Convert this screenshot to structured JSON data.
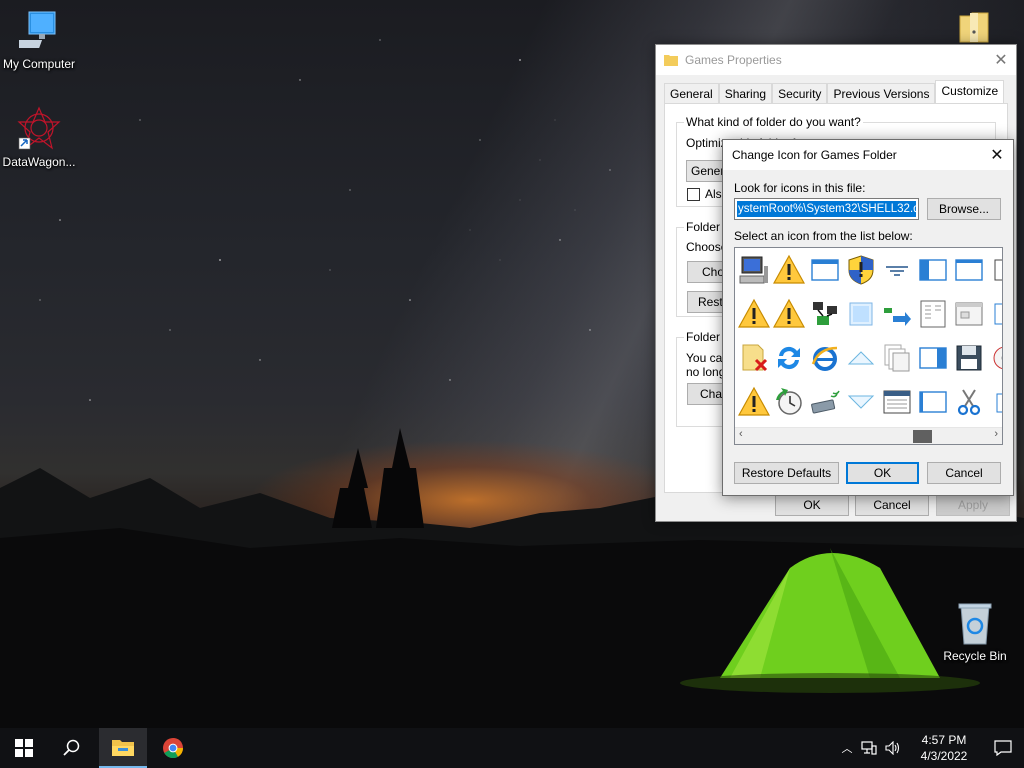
{
  "desktop": {
    "icons": [
      {
        "label": "My Computer"
      },
      {
        "label": "DataWagon..."
      },
      {
        "label": "Recycle Bin"
      }
    ]
  },
  "properties": {
    "title": "Games Properties",
    "tabs": [
      "General",
      "Sharing",
      "Security",
      "Previous Versions",
      "Customize"
    ],
    "selected_tab": "Customize",
    "group1_title": "What kind of folder do you want?",
    "optimize_label": "Optimize this folder for:",
    "optimize_value": "Genera",
    "also_apply_label": "Also",
    "group2_title": "Folder p",
    "choose_label": "Choose",
    "choose_button": "Cho",
    "restore_button": "Resto",
    "group3_title": "Folder ic",
    "you_can_label": "You can",
    "no_longer_label": "no longe",
    "change_button": "Char",
    "ok": "OK",
    "cancel": "Cancel",
    "apply": "Apply"
  },
  "change_icon": {
    "title": "Change Icon for Games Folder",
    "look_label": "Look for icons in this file:",
    "path_value": "ystemRoot%\\System32\\SHELL32.dll",
    "browse": "Browse...",
    "select_label": "Select an icon from the list below:",
    "icons": [
      "computer-monitor-icon",
      "warning-icon",
      "window-icon",
      "shield-icon",
      "filter-icon",
      "split-window-icon",
      "window-frame-icon",
      "warning-icon",
      "warning-icon",
      "network-icon",
      "blank-square-icon",
      "move-arrow-icon",
      "document-columns-icon",
      "dialog-window-icon",
      "folder-delete-icon",
      "refresh-icon",
      "internet-explorer-icon",
      "arrow-up-icon",
      "stacked-pages-icon",
      "window-pane-icon",
      "floppy-disk-icon",
      "warning-icon",
      "clock-icon",
      "usb-drive-icon",
      "arrow-down-icon",
      "grid-window-icon",
      "window-blank-icon",
      "scissors-icon"
    ],
    "restore_defaults": "Restore Defaults",
    "ok": "OK",
    "cancel": "Cancel"
  },
  "taskbar": {
    "time": "4:57 PM",
    "date": "4/3/2022"
  }
}
